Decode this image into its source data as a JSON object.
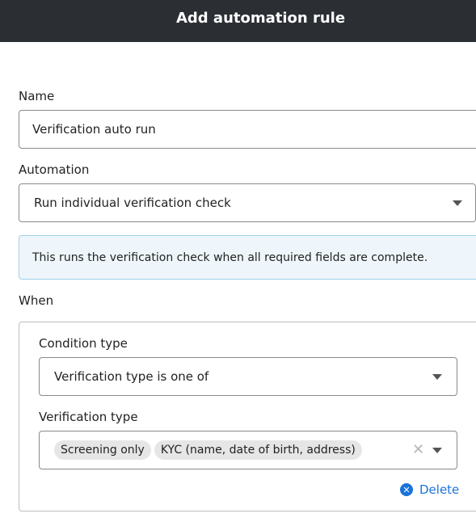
{
  "header": {
    "title": "Add automation rule"
  },
  "name": {
    "label": "Name",
    "value": "Verification auto run"
  },
  "automation": {
    "label": "Automation",
    "selected": "Run individual verification check"
  },
  "info_text": "This runs the verification check when all required fields are complete.",
  "when": {
    "label": "When",
    "condition_type": {
      "label": "Condition type",
      "selected": "Verification type is one of"
    },
    "verification_type": {
      "label": "Verification type",
      "chips": [
        "Screening only",
        "KYC (name, date of birth, address)"
      ]
    },
    "delete_label": "Delete"
  },
  "icons": {
    "dropdown": "chevron-down-icon",
    "clear": "close-icon",
    "delete": "close-circle-icon"
  },
  "colors": {
    "header_bg": "#2b2f33",
    "info_bg": "#eef6fb",
    "info_border": "#9fd0ea",
    "link": "#1a73d9"
  }
}
